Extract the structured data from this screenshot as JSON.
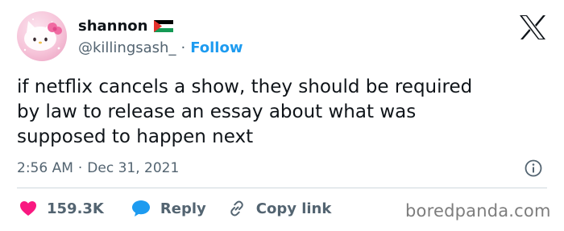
{
  "author": {
    "display_name": "shannon",
    "handle": "@killingsash_",
    "separator": "·",
    "follow_label": "Follow"
  },
  "tweet": {
    "text": "if netflix cancels a show, they should be required\nby law to release an essay about what was\nsupposed to happen next",
    "time": "2:56 AM",
    "separator": "·",
    "date": "Dec 31, 2021"
  },
  "actions": {
    "likes": "159.3K",
    "reply_label": "Reply",
    "copy_link_label": "Copy link"
  },
  "watermark": "boredpanda.com",
  "colors": {
    "accent": "#1d9bf0",
    "like": "#f91880",
    "text": "#0f1419",
    "muted": "#536471",
    "divider": "#cfd9de"
  },
  "icons": {
    "flag": "palestine-flag-icon",
    "brand": "x-logo-icon",
    "info": "info-icon",
    "like": "heart-icon",
    "reply": "reply-bubble-icon",
    "copy": "link-icon"
  }
}
